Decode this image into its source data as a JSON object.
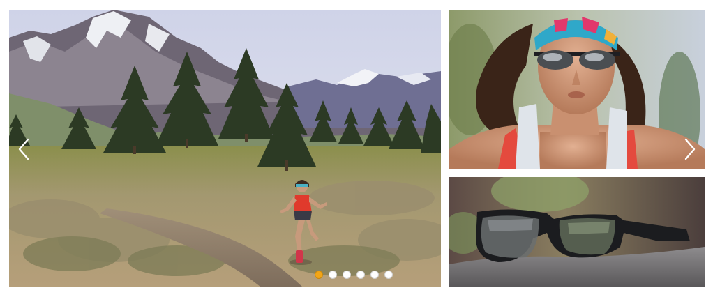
{
  "gallery": {
    "slides": [
      {
        "label": ""
      },
      {
        "label": ""
      },
      {
        "label": ""
      },
      {
        "label": ""
      },
      {
        "label": ""
      },
      {
        "label": ""
      }
    ],
    "active_slide": 0,
    "accent_color": "#f2a516",
    "images": {
      "main": "trail-runner-in-mountain-meadow",
      "portrait": "runner-with-sport-sunglasses",
      "product": "sport-sunglasses-on-rock"
    },
    "icons": {
      "prev": "chevron-left-icon",
      "next": "chevron-right-icon"
    }
  }
}
